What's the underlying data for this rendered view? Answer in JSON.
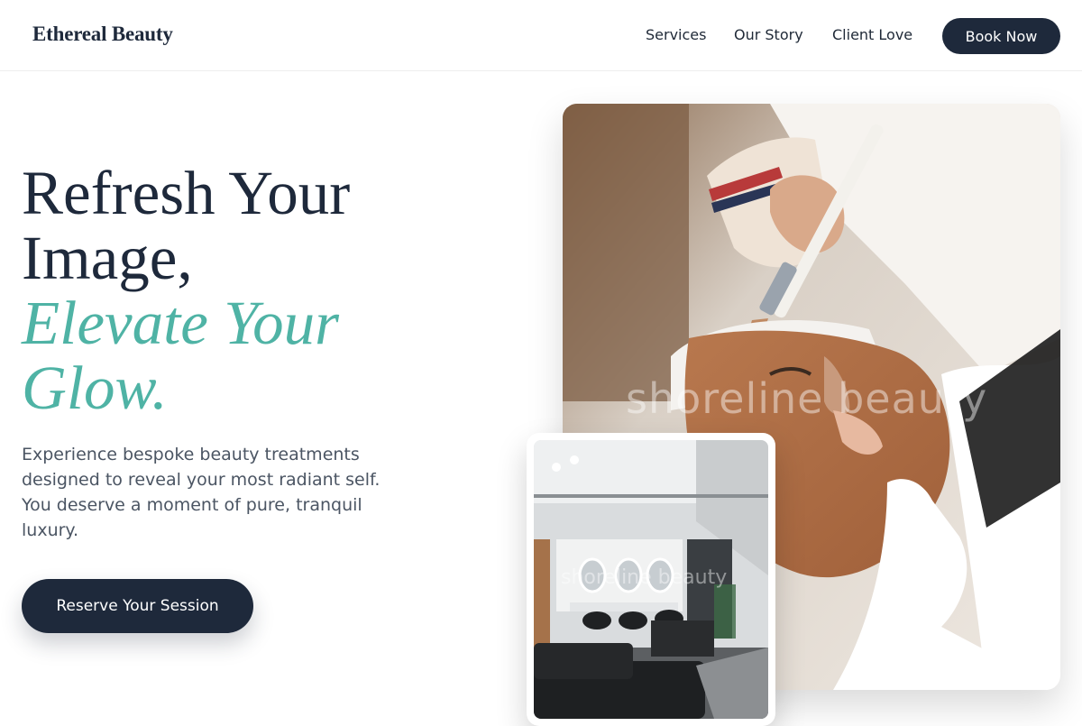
{
  "header": {
    "brand": "Ethereal Beauty",
    "nav": [
      "Services",
      "Our Story",
      "Client Love"
    ],
    "cta": "Book Now"
  },
  "hero": {
    "headline": {
      "line1": "Refresh Your",
      "line2": "Image,",
      "line3": "Elevate Your",
      "line4": "Glow."
    },
    "description": "Experience bespoke beauty treatments designed to reveal your most radiant self. You deserve a moment of pure, tranquil luxury.",
    "cta": "Reserve Your Session"
  },
  "images": {
    "main_watermark": "shoreline beauty",
    "inset_watermark": "shoreline beauty"
  },
  "colors": {
    "navy": "#1e293b",
    "teal_accent": "#4fb3a5"
  }
}
